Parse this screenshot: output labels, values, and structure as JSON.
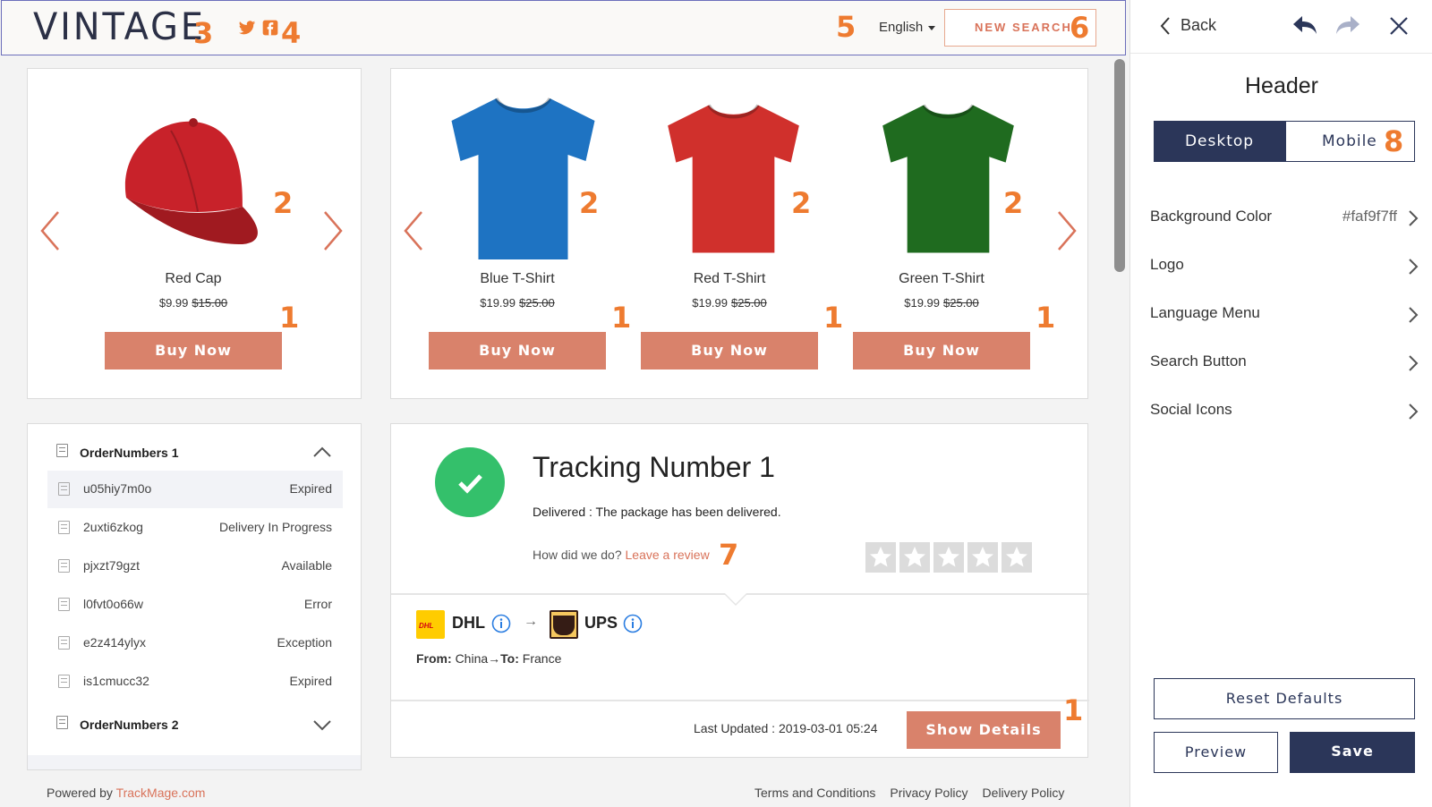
{
  "header": {
    "logo": "VINTAGE",
    "language": "English",
    "new_search": "NEW SEARCH",
    "annotations": {
      "logo": "3",
      "social": "4",
      "language": "5",
      "search": "6"
    },
    "social_icons": [
      "twitter-icon",
      "facebook-icon"
    ]
  },
  "products_left": {
    "items": [
      {
        "name": "Red Cap",
        "price": "$9.99",
        "old_price": "$15.00",
        "button": "Buy Now",
        "ann_img": "2",
        "ann_btn": "1"
      }
    ]
  },
  "products_right": {
    "items": [
      {
        "name": "Blue T-Shirt",
        "price": "$19.99",
        "old_price": "$25.00",
        "button": "Buy Now",
        "ann_img": "2",
        "ann_btn": "1",
        "color": "#1e73c2"
      },
      {
        "name": "Red T-Shirt",
        "price": "$19.99",
        "old_price": "$25.00",
        "button": "Buy Now",
        "ann_img": "2",
        "ann_btn": "1",
        "color": "#d0302c"
      },
      {
        "name": "Green T-Shirt",
        "price": "$19.99",
        "old_price": "$25.00",
        "button": "Buy Now",
        "ann_img": "2",
        "ann_btn": "1",
        "color": "#1f6b1f"
      }
    ]
  },
  "orders": {
    "group1": "OrderNumbers 1",
    "group2": "OrderNumbers 2",
    "rows": [
      {
        "code": "u05hiy7m0o",
        "status": "Expired"
      },
      {
        "code": "2uxti6zkog",
        "status": "Delivery In Progress"
      },
      {
        "code": "pjxzt79gzt",
        "status": "Available"
      },
      {
        "code": "l0fvt0o66w",
        "status": "Error"
      },
      {
        "code": "e2z414ylyx",
        "status": "Exception"
      },
      {
        "code": "is1cmucc32",
        "status": "Expired"
      }
    ]
  },
  "tracking": {
    "title": "Tracking Number 1",
    "status": "Delivered : The package has been delivered.",
    "review_q": "How did we do?",
    "review_link": "Leave a review",
    "review_ann": "7",
    "carrier_from": "DHL",
    "carrier_to": "UPS",
    "from_label": "From:",
    "from_val": "China",
    "to_label": "To:",
    "to_val": "France",
    "last_updated": "Last Updated : 2019-03-01 05:24",
    "details_button": "Show Details",
    "details_ann": "1"
  },
  "footer": {
    "powered": "Powered by",
    "powered_link": "TrackMage.com",
    "links": [
      "Terms and Conditions",
      "Privacy Policy",
      "Delivery Policy"
    ]
  },
  "panel": {
    "back": "Back",
    "title": "Header",
    "tab_desktop": "Desktop",
    "tab_mobile": "Mobile",
    "tab_ann": "8",
    "rows": [
      {
        "label": "Background Color",
        "value": "#faf9f7ff"
      },
      {
        "label": "Logo",
        "value": ""
      },
      {
        "label": "Language Menu",
        "value": ""
      },
      {
        "label": "Search Button",
        "value": ""
      },
      {
        "label": "Social Icons",
        "value": ""
      }
    ],
    "reset": "Reset Defaults",
    "preview": "Preview",
    "save": "Save"
  },
  "colors": {
    "accent": "#d9826b",
    "navy": "#2b3659",
    "annotation": "#ee7b30",
    "success": "#34c06b"
  }
}
